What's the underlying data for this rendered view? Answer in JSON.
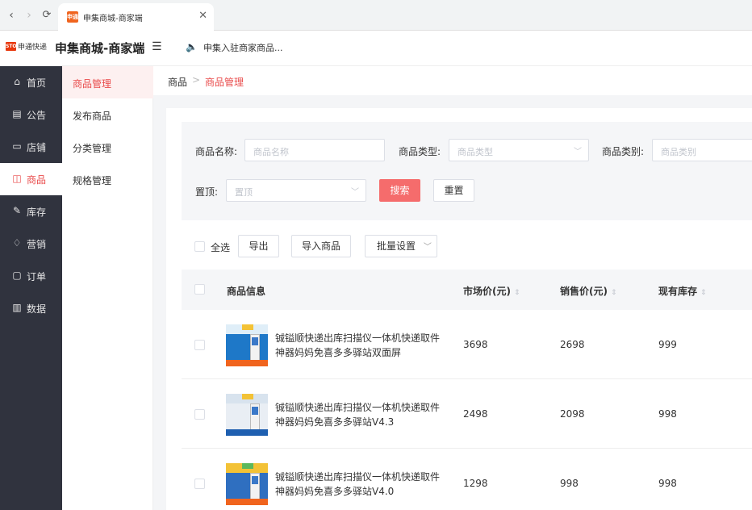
{
  "browser": {
    "back": "‹",
    "forward": "›",
    "reload": "⟳",
    "tab_title": "申集商城-商家端",
    "tab_close": "✕",
    "favicon_text": "申通"
  },
  "header": {
    "logo_mark": "STO",
    "logo_text": "申通快递",
    "title": "申集商城-商家端",
    "menu_toggle": "☰",
    "notice_icon": "🔈",
    "notice": "申集入驻商家商品..."
  },
  "sidebar": {
    "items": [
      {
        "icon": "⌂",
        "label": "首页"
      },
      {
        "icon": "▤",
        "label": "公告"
      },
      {
        "icon": "▭",
        "label": "店铺"
      },
      {
        "icon": "◫",
        "label": "商品"
      },
      {
        "icon": "✎",
        "label": "库存"
      },
      {
        "icon": "♢",
        "label": "营销"
      },
      {
        "icon": "▢",
        "label": "订单"
      },
      {
        "icon": "▥",
        "label": "数据"
      }
    ],
    "active_index": 3
  },
  "submenu": {
    "items": [
      "商品管理",
      "发布商品",
      "分类管理",
      "规格管理"
    ],
    "active_index": 0
  },
  "breadcrumb": {
    "home": "商品",
    "separator": ">",
    "current": "商品管理"
  },
  "filters": {
    "name_label": "商品名称:",
    "name_placeholder": "商品名称",
    "type_label": "商品类型:",
    "type_placeholder": "商品类型",
    "category_label": "商品类别:",
    "category_placeholder": "商品类别",
    "top_label": "置顶:",
    "top_placeholder": "置顶",
    "search_btn": "搜索",
    "reset_btn": "重置"
  },
  "toolbar": {
    "select_all": "全选",
    "export": "导出",
    "import": "导入商品",
    "batch": "批量设置"
  },
  "table": {
    "headers": {
      "info": "商品信息",
      "market_price": "市场价(元)",
      "sale_price": "销售价(元)",
      "stock": "现有库存"
    },
    "sort_icon": "⇕",
    "rows": [
      {
        "name": "铖镒顺快递出库扫描仪一体机快递取件神器妈妈免喜多多驿站双面屏",
        "market_price": "3698",
        "sale_price": "2698",
        "stock": "999"
      },
      {
        "name": "铖镒顺快递出库扫描仪一体机快递取件神器妈妈免喜多多驿站V4.3",
        "market_price": "2498",
        "sale_price": "2098",
        "stock": "998"
      },
      {
        "name": "铖镒顺快递出库扫描仪一体机快递取件神器妈妈免喜多多驿站V4.0",
        "market_price": "1298",
        "sale_price": "998",
        "stock": "998"
      }
    ]
  },
  "colors": {
    "accent": "#f56c6c",
    "sidebar_bg": "#30333e"
  }
}
